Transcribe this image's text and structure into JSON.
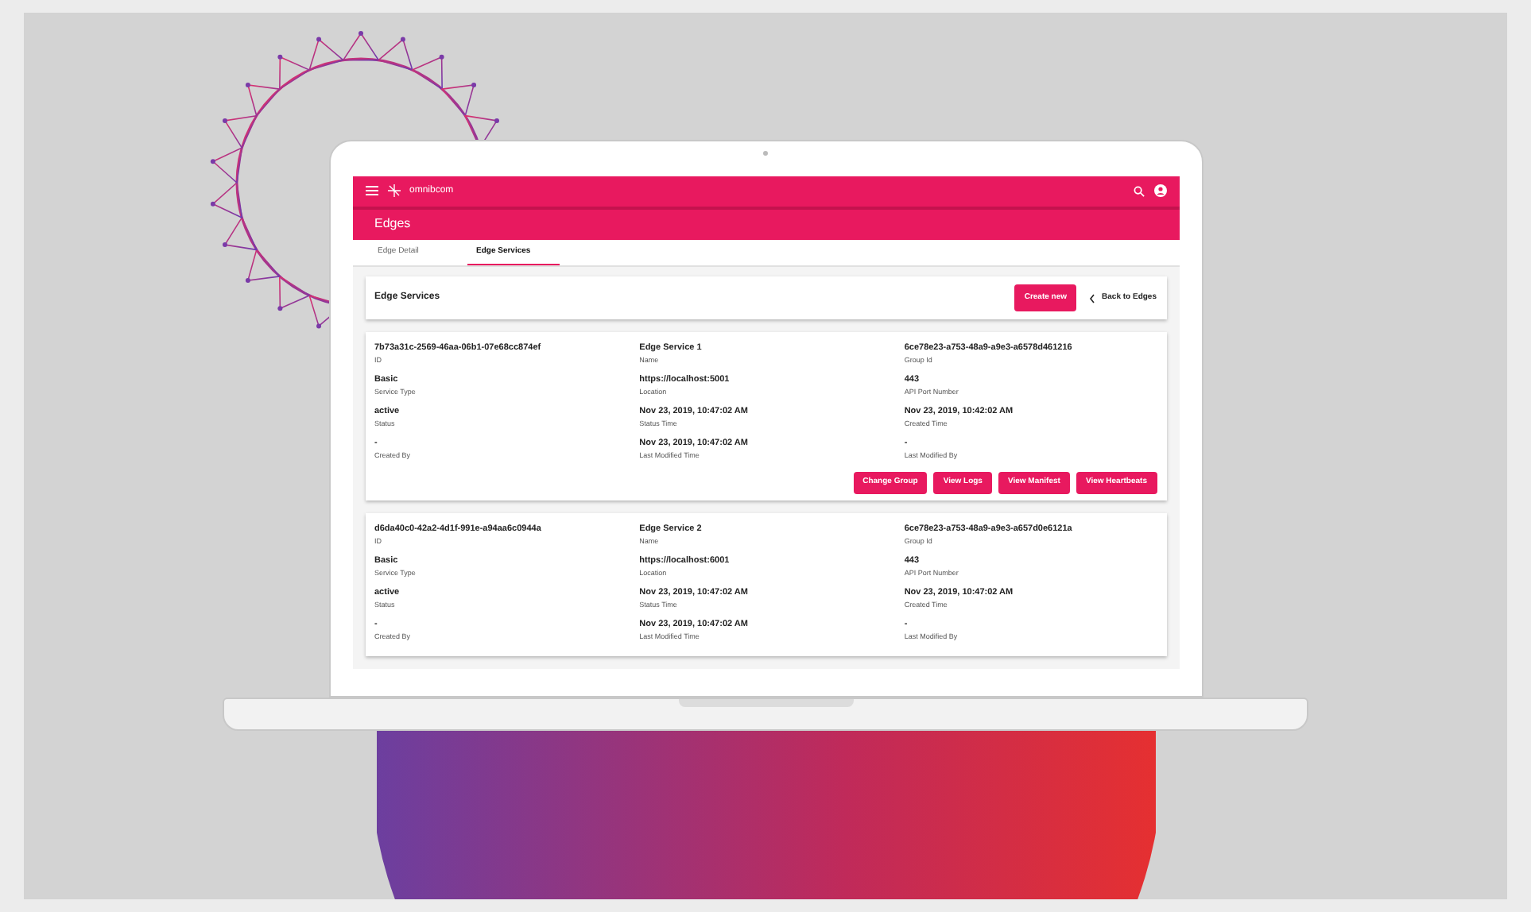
{
  "app": {
    "brand": "omnibcom",
    "page_title": "Edges"
  },
  "tabs": [
    {
      "label": "Edge Detail",
      "selected": false
    },
    {
      "label": "Edge Services",
      "selected": true
    }
  ],
  "section": {
    "title": "Edge Services",
    "create_button": "Create new",
    "back_link": "Back to Edges"
  },
  "cards": [
    {
      "fields": [
        {
          "value": "7b73a31c-2569-46aa-06b1-07e68cc874ef",
          "label": "ID"
        },
        {
          "value": "Edge Service 1",
          "label": "Name"
        },
        {
          "value": "6ce78e23-a753-48a9-a9e3-a6578d461216",
          "label": "Group Id"
        },
        {
          "value": "Basic",
          "label": "Service Type"
        },
        {
          "value": "https://localhost:5001",
          "label": "Location"
        },
        {
          "value": "443",
          "label": "API Port Number"
        },
        {
          "value": "active",
          "label": "Status"
        },
        {
          "value": "Nov 23, 2019, 10:47:02 AM",
          "label": "Status Time"
        },
        {
          "value": "Nov 23, 2019, 10:42:02 AM",
          "label": "Created Time"
        },
        {
          "value": "-",
          "label": "Created By"
        },
        {
          "value": "Nov 23, 2019, 10:47:02 AM",
          "label": "Last Modified Time"
        },
        {
          "value": "-",
          "label": "Last Modified By"
        }
      ],
      "actions": [
        "Change Group",
        "View Logs",
        "View Manifest",
        "View Heartbeats"
      ]
    },
    {
      "fields": [
        {
          "value": "d6da40c0-42a2-4d1f-991e-a94aa6c0944a",
          "label": "ID"
        },
        {
          "value": "Edge Service 2",
          "label": "Name"
        },
        {
          "value": "6ce78e23-a753-48a9-a9e3-a657d0e6121a",
          "label": "Group Id"
        },
        {
          "value": "Basic",
          "label": "Service Type"
        },
        {
          "value": "https://localhost:6001",
          "label": "Location"
        },
        {
          "value": "443",
          "label": "API Port Number"
        },
        {
          "value": "active",
          "label": "Status"
        },
        {
          "value": "Nov 23, 2019, 10:47:02 AM",
          "label": "Status Time"
        },
        {
          "value": "Nov 23, 2019, 10:47:02 AM",
          "label": "Created Time"
        },
        {
          "value": "-",
          "label": "Created By"
        },
        {
          "value": "Nov 23, 2019, 10:47:02 AM",
          "label": "Last Modified Time"
        },
        {
          "value": "-",
          "label": "Last Modified By"
        }
      ]
    }
  ]
}
